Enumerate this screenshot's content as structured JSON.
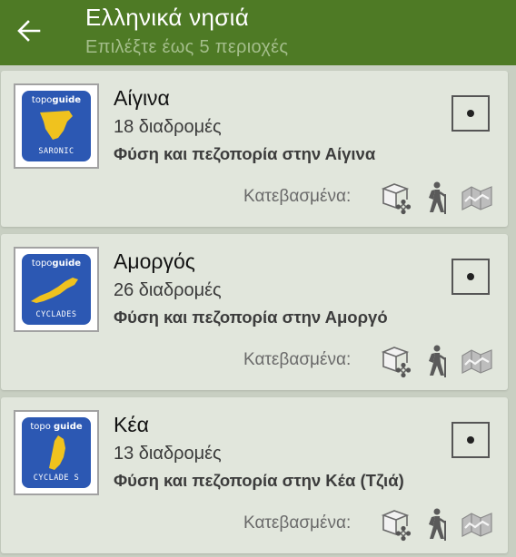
{
  "appbar": {
    "title": "Ελληνικά νησιά",
    "subtitle": "Επιλέξτε έως 5 περιοχές"
  },
  "items": [
    {
      "name": "Αίγινα",
      "routes": "18 διαδρομές",
      "description": "Φύση και πεζοπορία στην Αίγινα",
      "downloaded_label": "Κατεβασμένα:",
      "logo": {
        "brand_light": "topo",
        "brand_bold": "guide",
        "region": "SARONIC"
      }
    },
    {
      "name": "Αμοργός",
      "routes": "26 διαδρομές",
      "description": "Φύση και πεζοπορία στην Αμοργό",
      "downloaded_label": "Κατεβασμένα:",
      "logo": {
        "brand_light": "topo",
        "brand_bold": "guide",
        "region": "CYCLADES"
      }
    },
    {
      "name": "Κέα",
      "routes": "13 διαδρομές",
      "description": "Φύση και πεζοπορία στην Κέα (Τζιά)",
      "downloaded_label": "Κατεβασμένα:",
      "logo": {
        "brand_light": "topo",
        "brand_bold": "guide",
        "region": "CYCLADE S"
      }
    }
  ],
  "colors": {
    "appbar": "#4e7a25",
    "subtitle": "#a4be8b",
    "background": "#c8cfc2",
    "card": "#e1e6dc",
    "logo_blue": "#2c58b3",
    "island_yellow": "#f0c21e"
  },
  "icons": [
    "back-arrow-icon",
    "flora-guide-icon",
    "hiking-icon",
    "map-icon"
  ]
}
